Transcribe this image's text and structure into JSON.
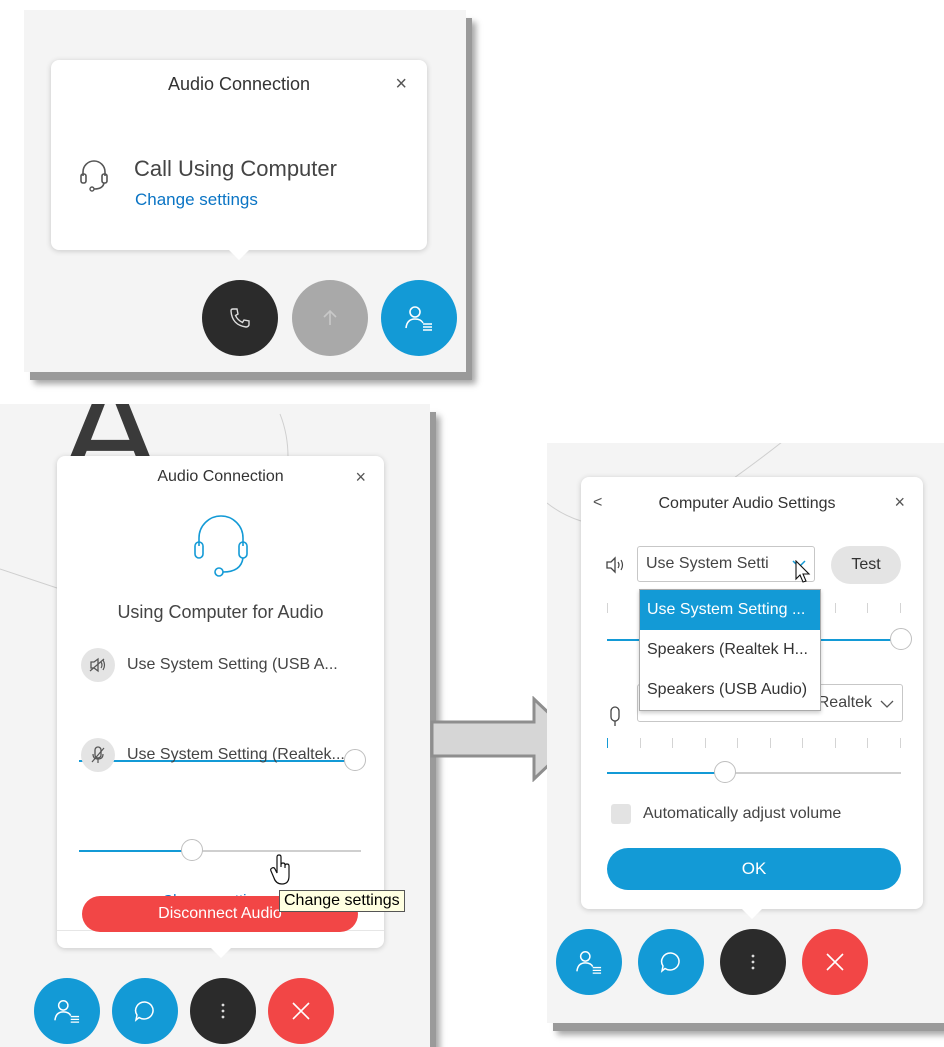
{
  "panel1": {
    "title": "Audio Connection",
    "close": "×",
    "call_label": "Call Using Computer",
    "change_settings": "Change settings"
  },
  "panel2": {
    "title": "Audio Connection",
    "close": "×",
    "status": "Using Computer for Audio",
    "speaker_device": "Use System Setting (USB A...",
    "speaker_level": 1.0,
    "mic_device": "Use System Setting (Realtek...",
    "mic_level": 0.4,
    "change_settings": "Change settings",
    "tooltip": "Change settings",
    "disconnect": "Disconnect Audio"
  },
  "panel3": {
    "back": "<",
    "title": "Computer Audio Settings",
    "close": "×",
    "speaker_select": "Use System Setti",
    "test": "Test",
    "dropdown_options": [
      "Use System Setting ...",
      "Speakers (Realtek H...",
      "Speakers (USB Audio)"
    ],
    "dropdown_selected_index": 0,
    "mic_select_partial": "Realtek",
    "speaker_level": 1.0,
    "mic_level": 0.4,
    "auto_adjust": "Automatically adjust volume",
    "ok": "OK"
  },
  "background_letters": "A",
  "colors": {
    "accent": "#139ad6",
    "danger": "#f24646",
    "dark": "#2b2b2b",
    "link": "#0a74c4"
  }
}
